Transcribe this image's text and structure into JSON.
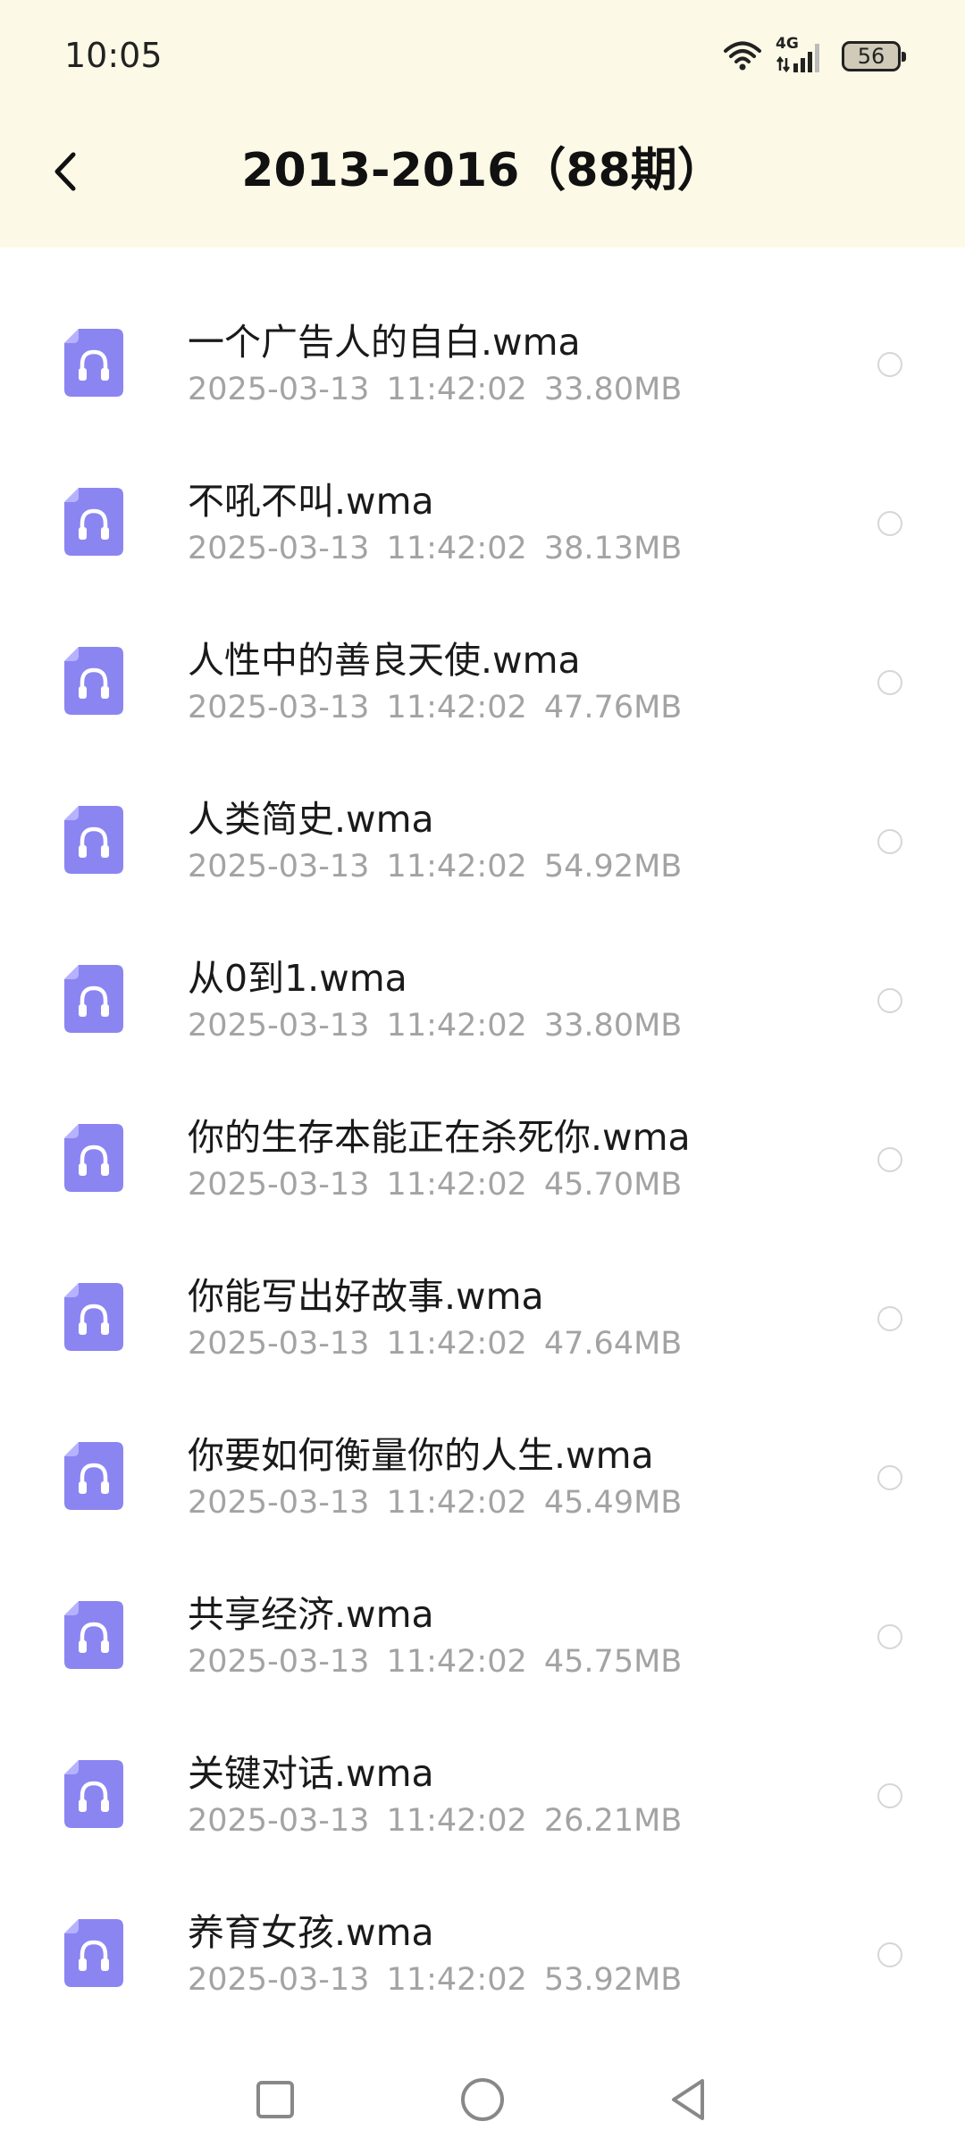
{
  "status_bar": {
    "time": "10:05",
    "network": "4G",
    "battery": "56"
  },
  "header": {
    "title": "2013-2016（88期）"
  },
  "files": [
    {
      "name": "一个广告人的自白.wma",
      "date": "2025-03-13",
      "time": "11:42:02",
      "size": "33.80MB"
    },
    {
      "name": "不吼不叫.wma",
      "date": "2025-03-13",
      "time": "11:42:02",
      "size": "38.13MB"
    },
    {
      "name": "人性中的善良天使.wma",
      "date": "2025-03-13",
      "time": "11:42:02",
      "size": "47.76MB"
    },
    {
      "name": "人类简史.wma",
      "date": "2025-03-13",
      "time": "11:42:02",
      "size": "54.92MB"
    },
    {
      "name": "从0到1.wma",
      "date": "2025-03-13",
      "time": "11:42:02",
      "size": "33.80MB"
    },
    {
      "name": "你的生存本能正在杀死你.wma",
      "date": "2025-03-13",
      "time": "11:42:02",
      "size": "45.70MB"
    },
    {
      "name": "你能写出好故事.wma",
      "date": "2025-03-13",
      "time": "11:42:02",
      "size": "47.64MB"
    },
    {
      "name": "你要如何衡量你的人生.wma",
      "date": "2025-03-13",
      "time": "11:42:02",
      "size": "45.49MB"
    },
    {
      "name": "共享经济.wma",
      "date": "2025-03-13",
      "time": "11:42:02",
      "size": "45.75MB"
    },
    {
      "name": "关键对话.wma",
      "date": "2025-03-13",
      "time": "11:42:02",
      "size": "26.21MB"
    },
    {
      "name": "养育女孩.wma",
      "date": "2025-03-13",
      "time": "11:42:02",
      "size": "53.92MB"
    }
  ],
  "colors": {
    "header_bg": "#fcf9e6",
    "icon_accent": "#8b85f2",
    "meta_text": "#a3a3a3"
  },
  "icons": {
    "file_type": "audio-file-icon",
    "back": "chevron-left-icon",
    "nav_recent": "square-icon",
    "nav_home": "circle-icon",
    "nav_back": "triangle-back-icon"
  }
}
